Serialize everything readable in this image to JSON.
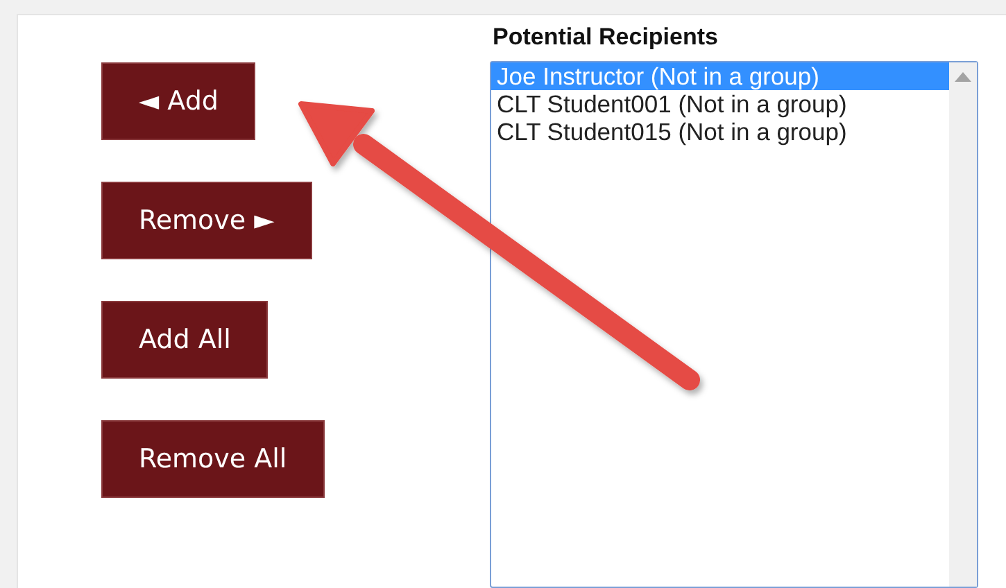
{
  "buttons": [
    {
      "label": "◄ Add"
    },
    {
      "label": "Remove ►"
    },
    {
      "label": "Add All"
    },
    {
      "label": "Remove All"
    }
  ],
  "recipients": {
    "title": "Potential Recipients",
    "items": [
      {
        "label": "Joe Instructor (Not in a group)",
        "selected": true
      },
      {
        "label": "CLT Student001 (Not in a group)",
        "selected": false
      },
      {
        "label": "CLT Student015 (Not in a group)",
        "selected": false
      }
    ]
  }
}
